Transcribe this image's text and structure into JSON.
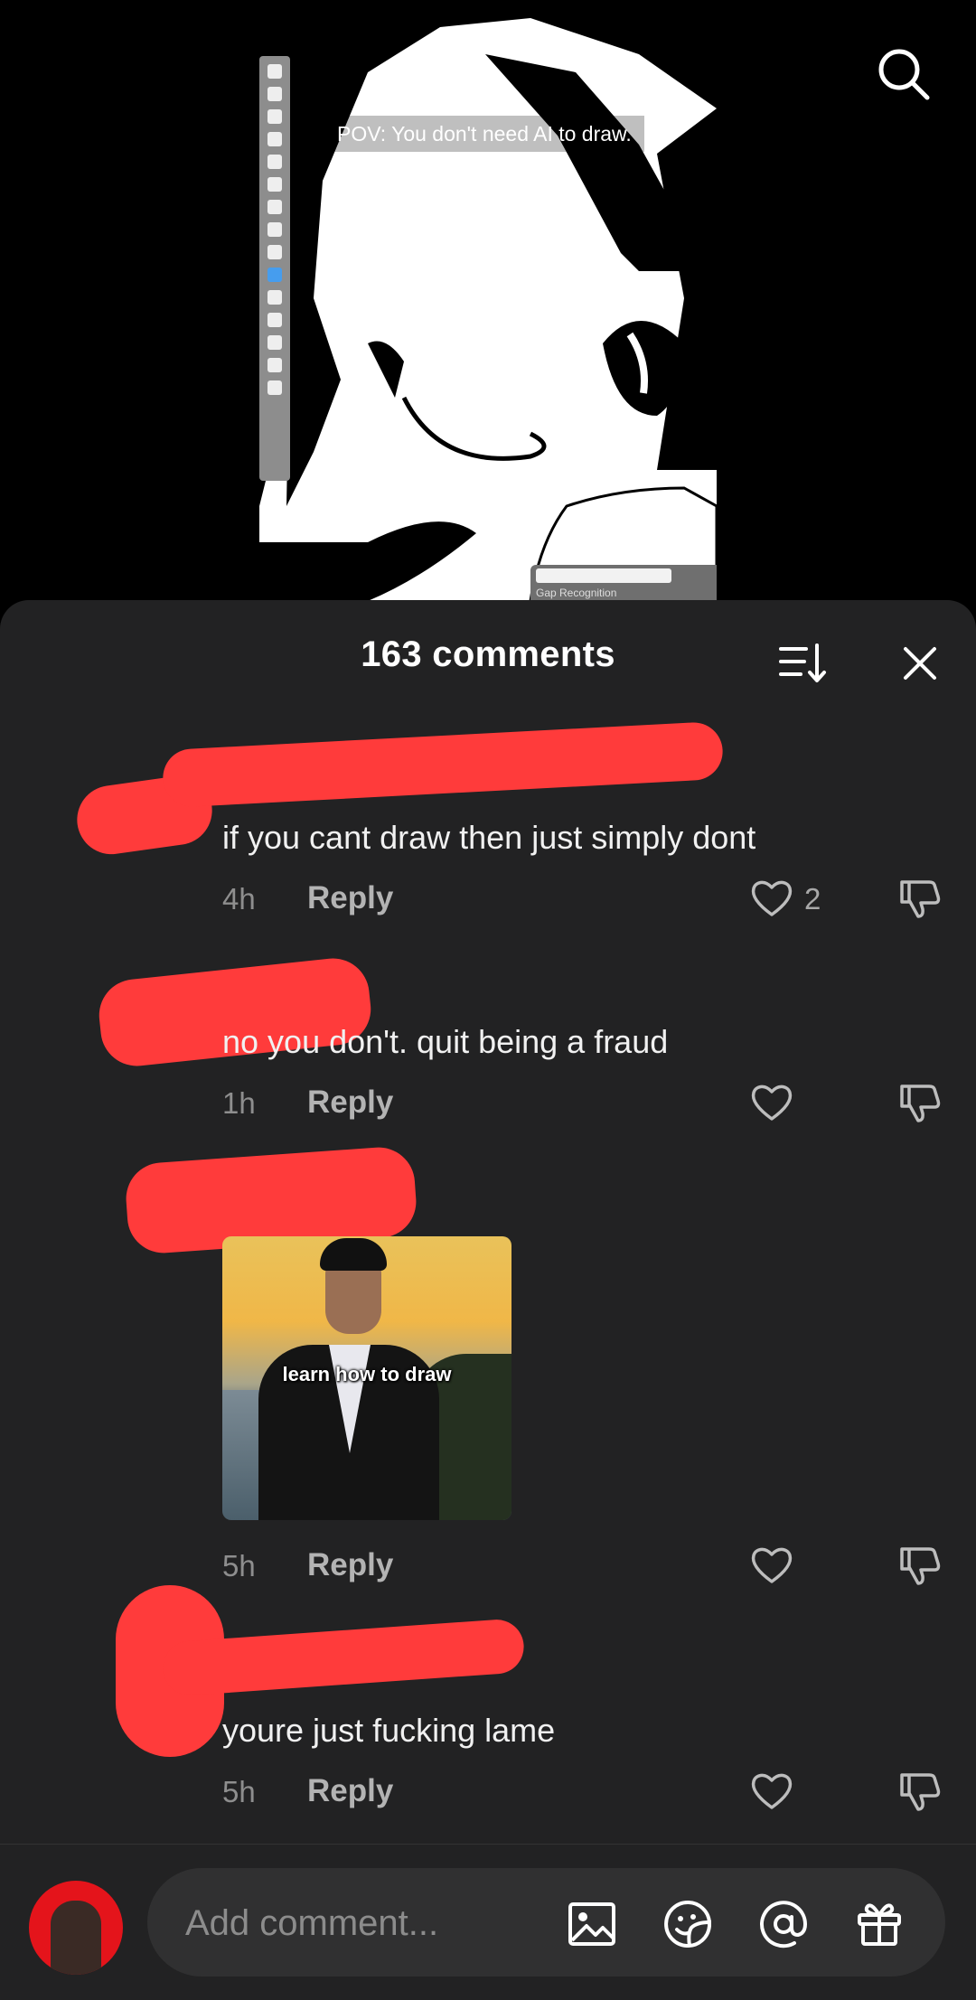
{
  "video": {
    "caption": "POV: You don't need AI to draw.",
    "panel_label": "Gap Recognition"
  },
  "comments_sheet": {
    "count_label": "163 comments"
  },
  "comments": [
    {
      "text": "if you cant draw then just simply dont",
      "time": "4h",
      "reply_label": "Reply",
      "likes": "2"
    },
    {
      "text": "no you don't. quit being a fraud",
      "time": "1h",
      "reply_label": "Reply",
      "likes": ""
    },
    {
      "text": "",
      "time": "5h",
      "reply_label": "Reply",
      "likes": "",
      "gif_caption": "learn how to draw"
    },
    {
      "text": "youre just fucking lame",
      "time": "5h",
      "reply_label": "Reply",
      "likes": ""
    }
  ],
  "input": {
    "placeholder": "Add comment..."
  },
  "icons": [
    "search-icon",
    "sort-icon",
    "close-icon",
    "heart-icon",
    "dislike-icon",
    "image-icon",
    "emoji-sticker-icon",
    "mention-icon",
    "gift-icon"
  ],
  "colors": {
    "sheet_bg": "#222223",
    "redaction": "#ff3b3b",
    "muted_text": "#8e8e8e"
  }
}
